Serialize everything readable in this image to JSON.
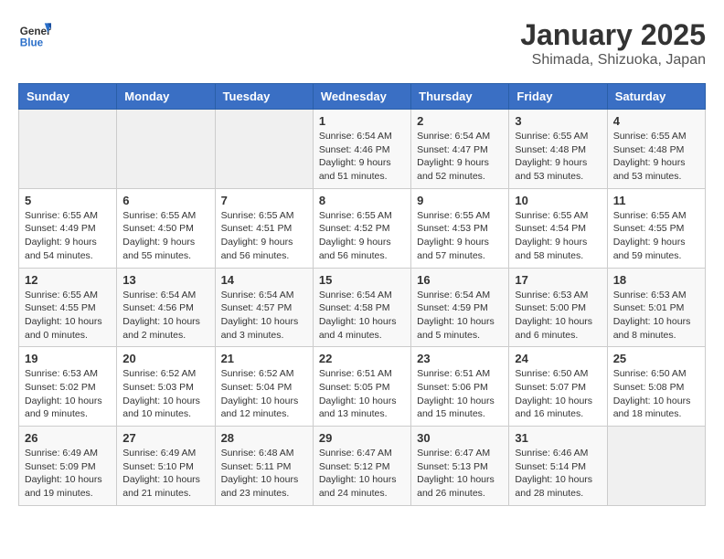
{
  "header": {
    "logo_general": "General",
    "logo_blue": "Blue",
    "title": "January 2025",
    "subtitle": "Shimada, Shizuoka, Japan"
  },
  "weekdays": [
    "Sunday",
    "Monday",
    "Tuesday",
    "Wednesday",
    "Thursday",
    "Friday",
    "Saturday"
  ],
  "weeks": [
    [
      {
        "day": "",
        "info": ""
      },
      {
        "day": "",
        "info": ""
      },
      {
        "day": "",
        "info": ""
      },
      {
        "day": "1",
        "info": "Sunrise: 6:54 AM\nSunset: 4:46 PM\nDaylight: 9 hours\nand 51 minutes."
      },
      {
        "day": "2",
        "info": "Sunrise: 6:54 AM\nSunset: 4:47 PM\nDaylight: 9 hours\nand 52 minutes."
      },
      {
        "day": "3",
        "info": "Sunrise: 6:55 AM\nSunset: 4:48 PM\nDaylight: 9 hours\nand 53 minutes."
      },
      {
        "day": "4",
        "info": "Sunrise: 6:55 AM\nSunset: 4:48 PM\nDaylight: 9 hours\nand 53 minutes."
      }
    ],
    [
      {
        "day": "5",
        "info": "Sunrise: 6:55 AM\nSunset: 4:49 PM\nDaylight: 9 hours\nand 54 minutes."
      },
      {
        "day": "6",
        "info": "Sunrise: 6:55 AM\nSunset: 4:50 PM\nDaylight: 9 hours\nand 55 minutes."
      },
      {
        "day": "7",
        "info": "Sunrise: 6:55 AM\nSunset: 4:51 PM\nDaylight: 9 hours\nand 56 minutes."
      },
      {
        "day": "8",
        "info": "Sunrise: 6:55 AM\nSunset: 4:52 PM\nDaylight: 9 hours\nand 56 minutes."
      },
      {
        "day": "9",
        "info": "Sunrise: 6:55 AM\nSunset: 4:53 PM\nDaylight: 9 hours\nand 57 minutes."
      },
      {
        "day": "10",
        "info": "Sunrise: 6:55 AM\nSunset: 4:54 PM\nDaylight: 9 hours\nand 58 minutes."
      },
      {
        "day": "11",
        "info": "Sunrise: 6:55 AM\nSunset: 4:55 PM\nDaylight: 9 hours\nand 59 minutes."
      }
    ],
    [
      {
        "day": "12",
        "info": "Sunrise: 6:55 AM\nSunset: 4:55 PM\nDaylight: 10 hours\nand 0 minutes."
      },
      {
        "day": "13",
        "info": "Sunrise: 6:54 AM\nSunset: 4:56 PM\nDaylight: 10 hours\nand 2 minutes."
      },
      {
        "day": "14",
        "info": "Sunrise: 6:54 AM\nSunset: 4:57 PM\nDaylight: 10 hours\nand 3 minutes."
      },
      {
        "day": "15",
        "info": "Sunrise: 6:54 AM\nSunset: 4:58 PM\nDaylight: 10 hours\nand 4 minutes."
      },
      {
        "day": "16",
        "info": "Sunrise: 6:54 AM\nSunset: 4:59 PM\nDaylight: 10 hours\nand 5 minutes."
      },
      {
        "day": "17",
        "info": "Sunrise: 6:53 AM\nSunset: 5:00 PM\nDaylight: 10 hours\nand 6 minutes."
      },
      {
        "day": "18",
        "info": "Sunrise: 6:53 AM\nSunset: 5:01 PM\nDaylight: 10 hours\nand 8 minutes."
      }
    ],
    [
      {
        "day": "19",
        "info": "Sunrise: 6:53 AM\nSunset: 5:02 PM\nDaylight: 10 hours\nand 9 minutes."
      },
      {
        "day": "20",
        "info": "Sunrise: 6:52 AM\nSunset: 5:03 PM\nDaylight: 10 hours\nand 10 minutes."
      },
      {
        "day": "21",
        "info": "Sunrise: 6:52 AM\nSunset: 5:04 PM\nDaylight: 10 hours\nand 12 minutes."
      },
      {
        "day": "22",
        "info": "Sunrise: 6:51 AM\nSunset: 5:05 PM\nDaylight: 10 hours\nand 13 minutes."
      },
      {
        "day": "23",
        "info": "Sunrise: 6:51 AM\nSunset: 5:06 PM\nDaylight: 10 hours\nand 15 minutes."
      },
      {
        "day": "24",
        "info": "Sunrise: 6:50 AM\nSunset: 5:07 PM\nDaylight: 10 hours\nand 16 minutes."
      },
      {
        "day": "25",
        "info": "Sunrise: 6:50 AM\nSunset: 5:08 PM\nDaylight: 10 hours\nand 18 minutes."
      }
    ],
    [
      {
        "day": "26",
        "info": "Sunrise: 6:49 AM\nSunset: 5:09 PM\nDaylight: 10 hours\nand 19 minutes."
      },
      {
        "day": "27",
        "info": "Sunrise: 6:49 AM\nSunset: 5:10 PM\nDaylight: 10 hours\nand 21 minutes."
      },
      {
        "day": "28",
        "info": "Sunrise: 6:48 AM\nSunset: 5:11 PM\nDaylight: 10 hours\nand 23 minutes."
      },
      {
        "day": "29",
        "info": "Sunrise: 6:47 AM\nSunset: 5:12 PM\nDaylight: 10 hours\nand 24 minutes."
      },
      {
        "day": "30",
        "info": "Sunrise: 6:47 AM\nSunset: 5:13 PM\nDaylight: 10 hours\nand 26 minutes."
      },
      {
        "day": "31",
        "info": "Sunrise: 6:46 AM\nSunset: 5:14 PM\nDaylight: 10 hours\nand 28 minutes."
      },
      {
        "day": "",
        "info": ""
      }
    ]
  ]
}
